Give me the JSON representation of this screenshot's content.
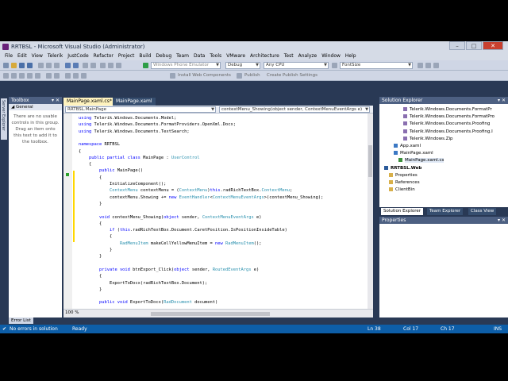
{
  "window": {
    "title": "RRTBSL - Microsoft Visual Studio (Administrator)"
  },
  "menu": [
    "File",
    "Edit",
    "View",
    "Telerik",
    "JustCode",
    "Refactor",
    "Project",
    "Build",
    "Debug",
    "Team",
    "Data",
    "Tools",
    "VMware",
    "Architecture",
    "Test",
    "Analyze",
    "Window",
    "Help"
  ],
  "toolbar": {
    "target": "Windows Phone Emulator",
    "config": "Debug",
    "platform": "Any CPU",
    "find": "FontSize",
    "install_web_components": "Install Web Components",
    "publish": "Publish",
    "create_publish_settings": "Create Publish Settings"
  },
  "toolbox": {
    "title": "Toolbox",
    "group": "General",
    "message": "There are no usable controls in this group. Drag an item onto this text to add it to the toolbox."
  },
  "server_explorer_tab": "Server Explorer",
  "editor": {
    "tabs": [
      "MainPage.xaml.cs*",
      "MainPage.xaml"
    ],
    "nav_left": "RRTBSL.MainPage",
    "nav_right": "contextMenu_Showing(object sender, ContextMenuEventArgs e)",
    "zoom": "100 %",
    "lines": [
      "using Telerik.Windows.Documents.Model;",
      "using Telerik.Windows.Documents.FormatProviders.OpenXml.Docx;",
      "using Telerik.Windows.Documents.TextSearch;",
      "",
      "namespace RRTBSL",
      "{",
      "    public partial class MainPage : UserControl",
      "    {",
      "        public MainPage()",
      "        {",
      "            InitializeComponent();",
      "            ContextMenu contextMenu = (ContextMenu)this.radRichTextBox.ContextMenu;",
      "            contextMenu.Showing += new EventHandler<ContextMenuEventArgs>(contextMenu_Showing);",
      "        }",
      "",
      "        void contextMenu_Showing(object sender, ContextMenuEventArgs e)",
      "        {",
      "            if (this.radRichTextBox.Document.CaretPosition.IsPositionInsideTable)",
      "            {",
      "                RadMenuItem makeCellYellowMenuItem = new RadMenuItem();",
      "            }",
      "        }",
      "",
      "        private void btnExport_Click(object sender, RoutedEventArgs e)",
      "        {",
      "            ExportToDocx(radRichTextBox.Document);",
      "        }",
      "",
      "        public void ExportToDocx(RadDocument document)"
    ]
  },
  "solution_explorer": {
    "title": "Solution Explorer",
    "items": [
      {
        "label": "Telerik.Windows.Documents.FormatPr",
        "indent": 5,
        "icon": "reference"
      },
      {
        "label": "Telerik.Windows.Documents.FormatPro",
        "indent": 5,
        "icon": "reference"
      },
      {
        "label": "Telerik.Windows.Documents.Proofing",
        "indent": 5,
        "icon": "reference"
      },
      {
        "label": "Telerik.Windows.Documents.Proofing.I",
        "indent": 5,
        "icon": "reference"
      },
      {
        "label": "Telerik.Windows.Zip",
        "indent": 5,
        "icon": "reference"
      },
      {
        "label": "App.xaml",
        "indent": 3,
        "icon": "xaml"
      },
      {
        "label": "MainPage.xaml",
        "indent": 3,
        "icon": "xaml"
      },
      {
        "label": "MainPage.xaml.cs",
        "indent": 4,
        "icon": "cs"
      },
      {
        "label": "RRTBSL.Web",
        "indent": 1,
        "icon": "project"
      },
      {
        "label": "Properties",
        "indent": 2,
        "icon": "folder"
      },
      {
        "label": "References",
        "indent": 2,
        "icon": "folder"
      },
      {
        "label": "ClientBin",
        "indent": 2,
        "icon": "folder"
      }
    ],
    "tabs": [
      "Solution Explorer",
      "Team Explorer",
      "Class View"
    ]
  },
  "properties": {
    "title": "Properties"
  },
  "error_list": {
    "label": "Error List"
  },
  "status": {
    "errors": "No errors in solution",
    "ready": "Ready",
    "ln": "Ln 38",
    "col": "Col 17",
    "ch": "Ch 17",
    "ins": "INS"
  },
  "colors": {
    "ide_background": "#293955",
    "active_tab": "#fff3be",
    "statusbar": "#0d5ea8",
    "keyword": "#0000ff",
    "type": "#2b91af"
  }
}
